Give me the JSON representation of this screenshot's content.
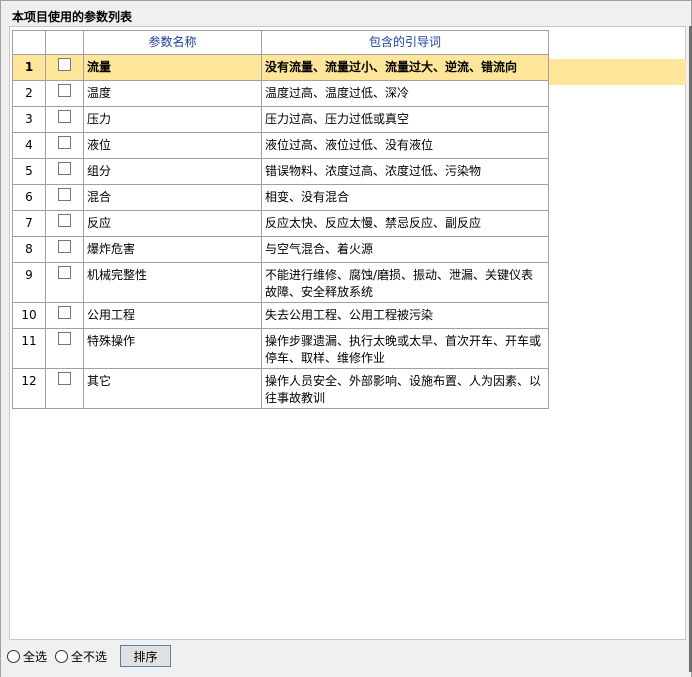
{
  "panel": {
    "title": "本项目使用的参数列表"
  },
  "table": {
    "headers": {
      "param": "参数名称",
      "words": "包含的引导词"
    },
    "rows": [
      {
        "num": "1",
        "name": "流量",
        "words": "没有流量、流量过小、流量过大、逆流、错流向",
        "selected": true
      },
      {
        "num": "2",
        "name": "温度",
        "words": "温度过高、温度过低、深冷"
      },
      {
        "num": "3",
        "name": "压力",
        "words": "压力过高、压力过低或真空"
      },
      {
        "num": "4",
        "name": "液位",
        "words": "液位过高、液位过低、没有液位"
      },
      {
        "num": "5",
        "name": "组分",
        "words": "错误物料、浓度过高、浓度过低、污染物"
      },
      {
        "num": "6",
        "name": "混合",
        "words": "相变、没有混合"
      },
      {
        "num": "7",
        "name": "反应",
        "words": "反应太快、反应太慢、禁忌反应、副反应"
      },
      {
        "num": "8",
        "name": "爆炸危害",
        "words": "与空气混合、着火源"
      },
      {
        "num": "9",
        "name": "机械完整性",
        "words": "不能进行维修、腐蚀/磨损、振动、泄漏、关键仪表故障、安全释放系统"
      },
      {
        "num": "10",
        "name": "公用工程",
        "words": "失去公用工程、公用工程被污染"
      },
      {
        "num": "11",
        "name": "特殊操作",
        "words": "操作步骤遗漏、执行太晚或太早、首次开车、开车或停车、取样、维修作业"
      },
      {
        "num": "12",
        "name": "其它",
        "words": "操作人员安全、外部影响、设施布置、人为因素、以往事故教训"
      }
    ]
  },
  "bottom": {
    "select_all": "全选",
    "select_none": "全不选",
    "sort_button": "排序"
  },
  "colors": {
    "selected_row": "#fde59a",
    "header_text": "#1f3d99"
  }
}
